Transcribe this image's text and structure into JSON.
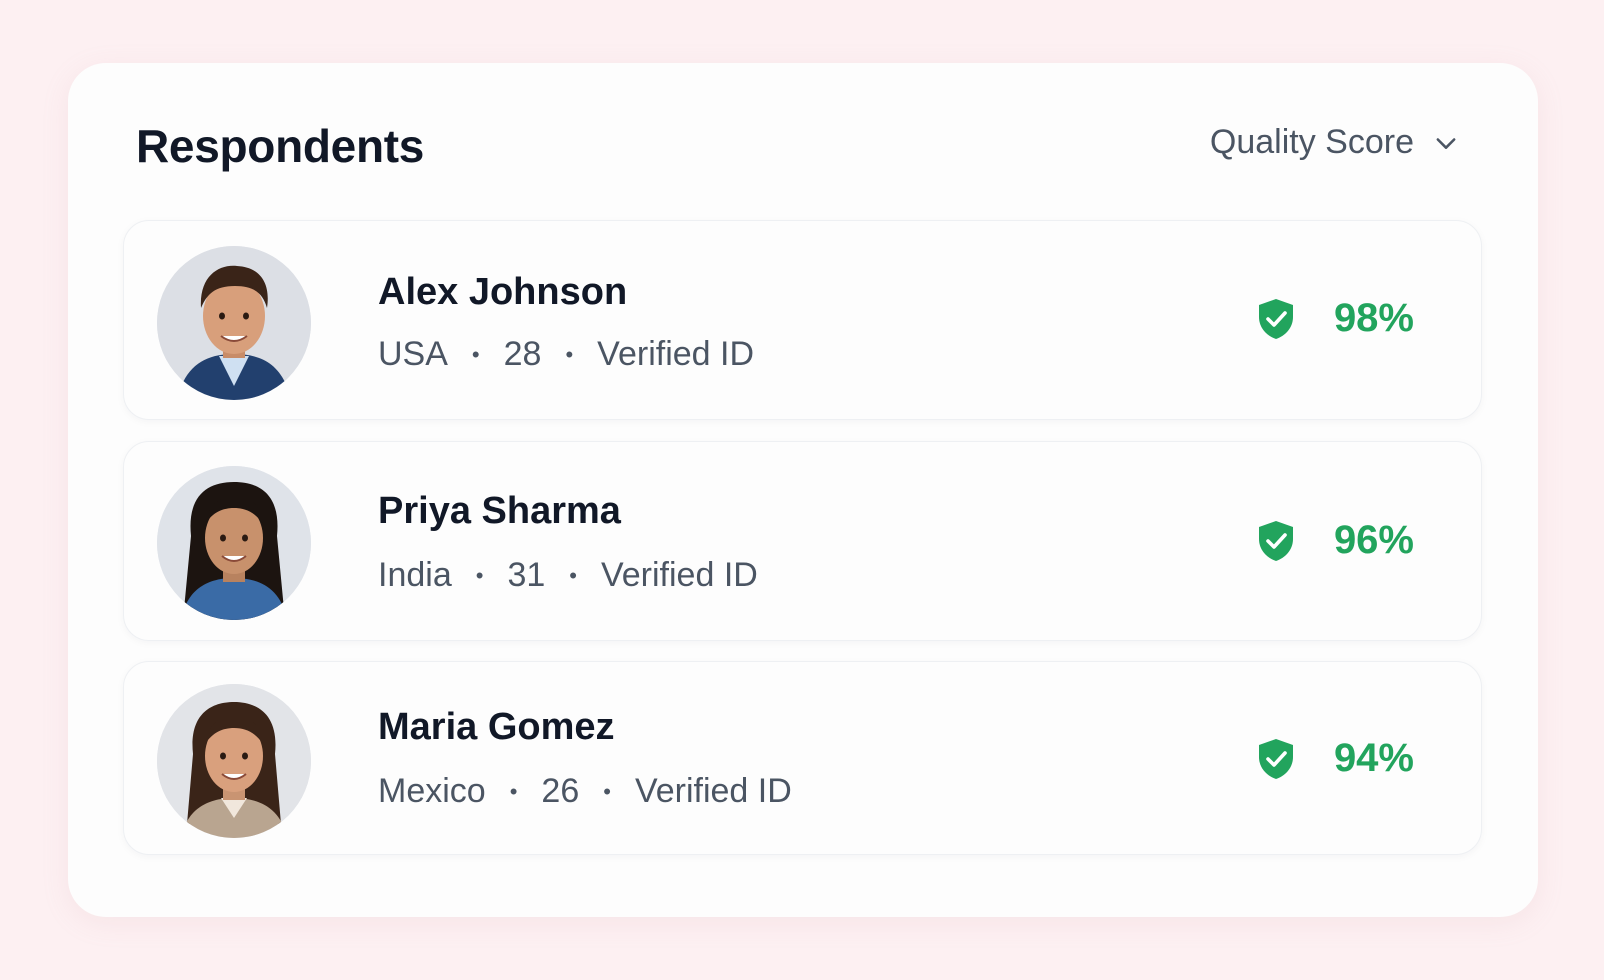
{
  "header": {
    "title": "Respondents",
    "sort_label": "Quality Score",
    "sort_icon": "chevron-down-icon"
  },
  "colors": {
    "background": "#fdf0f2",
    "card": "#fdfdfd",
    "score_green": "#22a45d",
    "name_text": "#111827",
    "meta_text": "#4b5563"
  },
  "respondents": [
    {
      "name": "Alex Johnson",
      "country": "USA",
      "age": "28",
      "status": "Verified ID",
      "score": "98%",
      "score_icon": "shield-check-icon"
    },
    {
      "name": "Priya Sharma",
      "country": "India",
      "age": "31",
      "status": "Verified ID",
      "score": "96%",
      "score_icon": "shield-check-icon"
    },
    {
      "name": "Maria Gomez",
      "country": "Mexico",
      "age": "26",
      "status": "Verified ID",
      "score": "94%",
      "score_icon": "shield-check-icon"
    }
  ]
}
